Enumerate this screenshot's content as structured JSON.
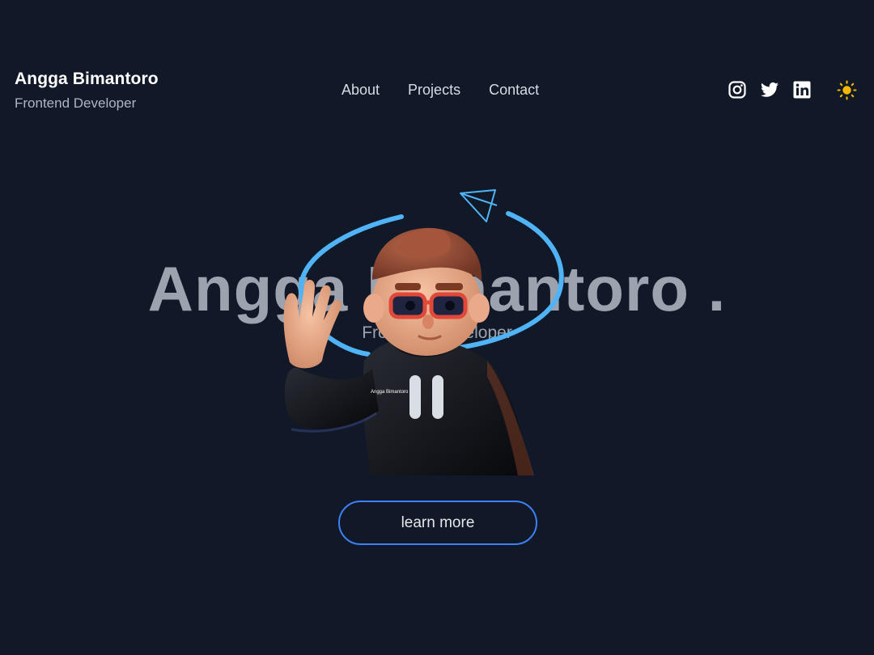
{
  "header": {
    "name": "Angga Bimantoro",
    "role": "Frontend Developer",
    "nav": [
      {
        "label": "About"
      },
      {
        "label": "Projects"
      },
      {
        "label": "Contact"
      }
    ],
    "social": [
      "instagram-icon",
      "twitter-icon",
      "linkedin-icon"
    ],
    "theme_icon": "sun-icon"
  },
  "hero": {
    "title": "Angga Bimantoro .",
    "subtitle": "Frontend Developer",
    "avatar_caption": "Angga Bimantoro",
    "cta_label": "learn more"
  },
  "colors": {
    "background": "#111827",
    "accent_border": "#3b82f6",
    "orbit": "#4fb3f5",
    "sun": "#f5b800",
    "muted_text": "#9ca3af"
  }
}
